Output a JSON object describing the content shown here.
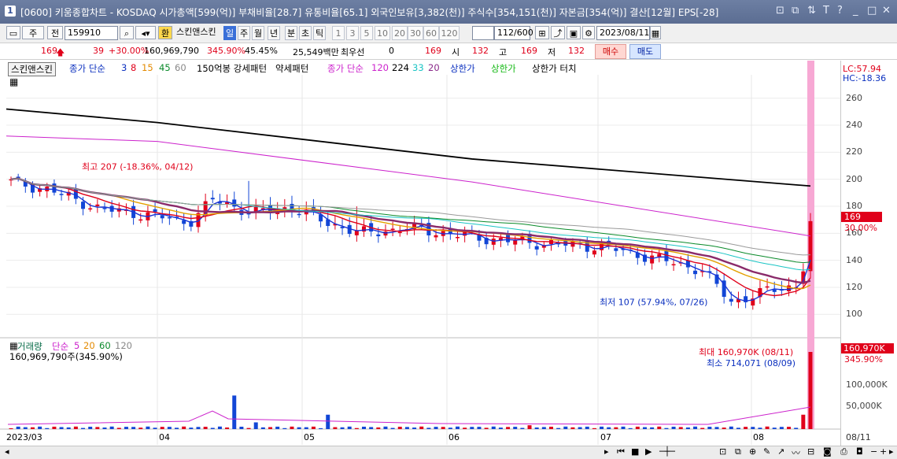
{
  "window": {
    "number": "1",
    "title": "[0600] 키움종합차트 - KOSDAQ 시가총액[599(억)] 부채비율[28.7] 유통비율[65.1] 외국인보유[3,382(천)] 주식수[354,151(천)] 자본금[354(억)] 결산[12월] EPS[-28]",
    "controls": [
      "⊡",
      "⧉",
      "⇅",
      "T",
      "?",
      "_",
      "□",
      "X"
    ]
  },
  "toolbar": {
    "type_label": "주",
    "prev_label": "전",
    "code_value": "159910",
    "highlight_label": "환",
    "stock_name": "스킨앤스킨",
    "tabs": [
      "일",
      "주",
      "월",
      "년",
      "분",
      "초",
      "틱"
    ],
    "active_tab": "일",
    "periods": [
      "1",
      "3",
      "5",
      "10",
      "20",
      "30",
      "60",
      "120"
    ],
    "count_value": "112/600",
    "date_value": "2023/08/11"
  },
  "quote": {
    "price": "169",
    "change": "39",
    "change_pct": "+30.00%",
    "volume": "160,969,790",
    "volume_pct": "345.90%",
    "turnover": "45.45%",
    "amount": "25,549백만",
    "preferred_label": "최우선",
    "preferred_value": "0",
    "preferred_price": "169",
    "open_label": "시",
    "open_value": "132",
    "high_label": "고",
    "high_value": "169",
    "low_label": "저",
    "low_value": "132",
    "buy_label": "매수",
    "sell_label": "매도"
  },
  "price_legend": {
    "stock": "스킨앤스킨",
    "ma_label": "종가 단순",
    "ma_periods": [
      "3",
      "8",
      "15",
      "45",
      "60"
    ],
    "pattern1": "150억봉 강세패턴",
    "pattern2": "약세패턴",
    "ma2_label": "종가 단순",
    "ma2_periods": [
      "120",
      "224",
      "33",
      "20"
    ],
    "limit1": "상한가",
    "limit2": "상한가",
    "limit3": "상한가 터치"
  },
  "volume_legend": {
    "label": "거래량",
    "ma_label": "단순",
    "periods": [
      "5",
      "20",
      "60",
      "120"
    ],
    "current": "160,969,790주(345.90%)"
  },
  "chart_data": [
    {
      "type": "candlestick",
      "title": "",
      "x_labels": [
        "2023/03",
        "04",
        "05",
        "06",
        "07",
        "08",
        "08/11"
      ],
      "y_ticks": [
        100,
        120,
        140,
        160,
        180,
        200,
        220,
        240,
        260
      ],
      "ylim": [
        85,
        275
      ],
      "right_labels": {
        "lc": "LC:57.94",
        "hc": "HC:-18.36",
        "last": "169",
        "last_pct": "30.00%"
      },
      "annotations": [
        {
          "text": "최고 207 (-18.36%, 04/12)",
          "value": 207
        },
        {
          "text": "최저 107 (57.94%, 07/26)",
          "value": 107
        }
      ],
      "close_points": [
        [
          "2023-03-02",
          198
        ],
        [
          "2023-03-10",
          192
        ],
        [
          "2023-03-20",
          178
        ],
        [
          "2023-03-31",
          173
        ],
        [
          "2023-04-07",
          168
        ],
        [
          "2023-04-12",
          185
        ],
        [
          "2023-04-20",
          175
        ],
        [
          "2023-04-28",
          179
        ],
        [
          "2023-05-05",
          168
        ],
        [
          "2023-05-12",
          160
        ],
        [
          "2023-05-22",
          164
        ],
        [
          "2023-05-31",
          159
        ],
        [
          "2023-06-09",
          155
        ],
        [
          "2023-06-20",
          152
        ],
        [
          "2023-06-30",
          150
        ],
        [
          "2023-07-10",
          142
        ],
        [
          "2023-07-20",
          133
        ],
        [
          "2023-07-26",
          109
        ],
        [
          "2023-08-03",
          118
        ],
        [
          "2023-08-09",
          122
        ],
        [
          "2023-08-11",
          169
        ]
      ]
    },
    {
      "type": "bar",
      "title": "",
      "y_ticks": [
        "50,000K",
        "100,000K"
      ],
      "right_labels": {
        "last": "160,970K",
        "last_pct": "345.90%"
      },
      "annotations": [
        {
          "text": "최대 160,970K (08/11)"
        },
        {
          "text": "최소 714,071 (08/09)"
        }
      ]
    }
  ],
  "bottom_axis": [
    "2023/03",
    "04",
    "05",
    "06",
    "07",
    "08",
    "08/11"
  ]
}
